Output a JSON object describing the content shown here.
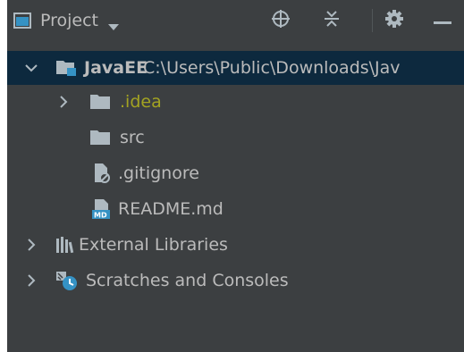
{
  "header": {
    "title": "Project",
    "icons": [
      "project-window-icon",
      "dropdown-icon",
      "locate-icon",
      "collapse-all-icon",
      "settings-icon",
      "hide-icon"
    ]
  },
  "tree": {
    "root": {
      "name": "JavaEE",
      "path": "C:\\Users\\Public\\Downloads\\Jav"
    },
    "items": [
      {
        "label": ".idea"
      },
      {
        "label": "src"
      },
      {
        "label": ".gitignore"
      },
      {
        "label": "README.md"
      },
      {
        "label": "External Libraries"
      },
      {
        "label": "Scratches and Consoles"
      }
    ]
  },
  "colors": {
    "background": "#3c3f41",
    "selection": "#0d293e",
    "text": "#bbbbbb",
    "ignored_text": "#a3a322",
    "folder_icon": "#aeb9c0",
    "module_accent": "#3592c4"
  }
}
